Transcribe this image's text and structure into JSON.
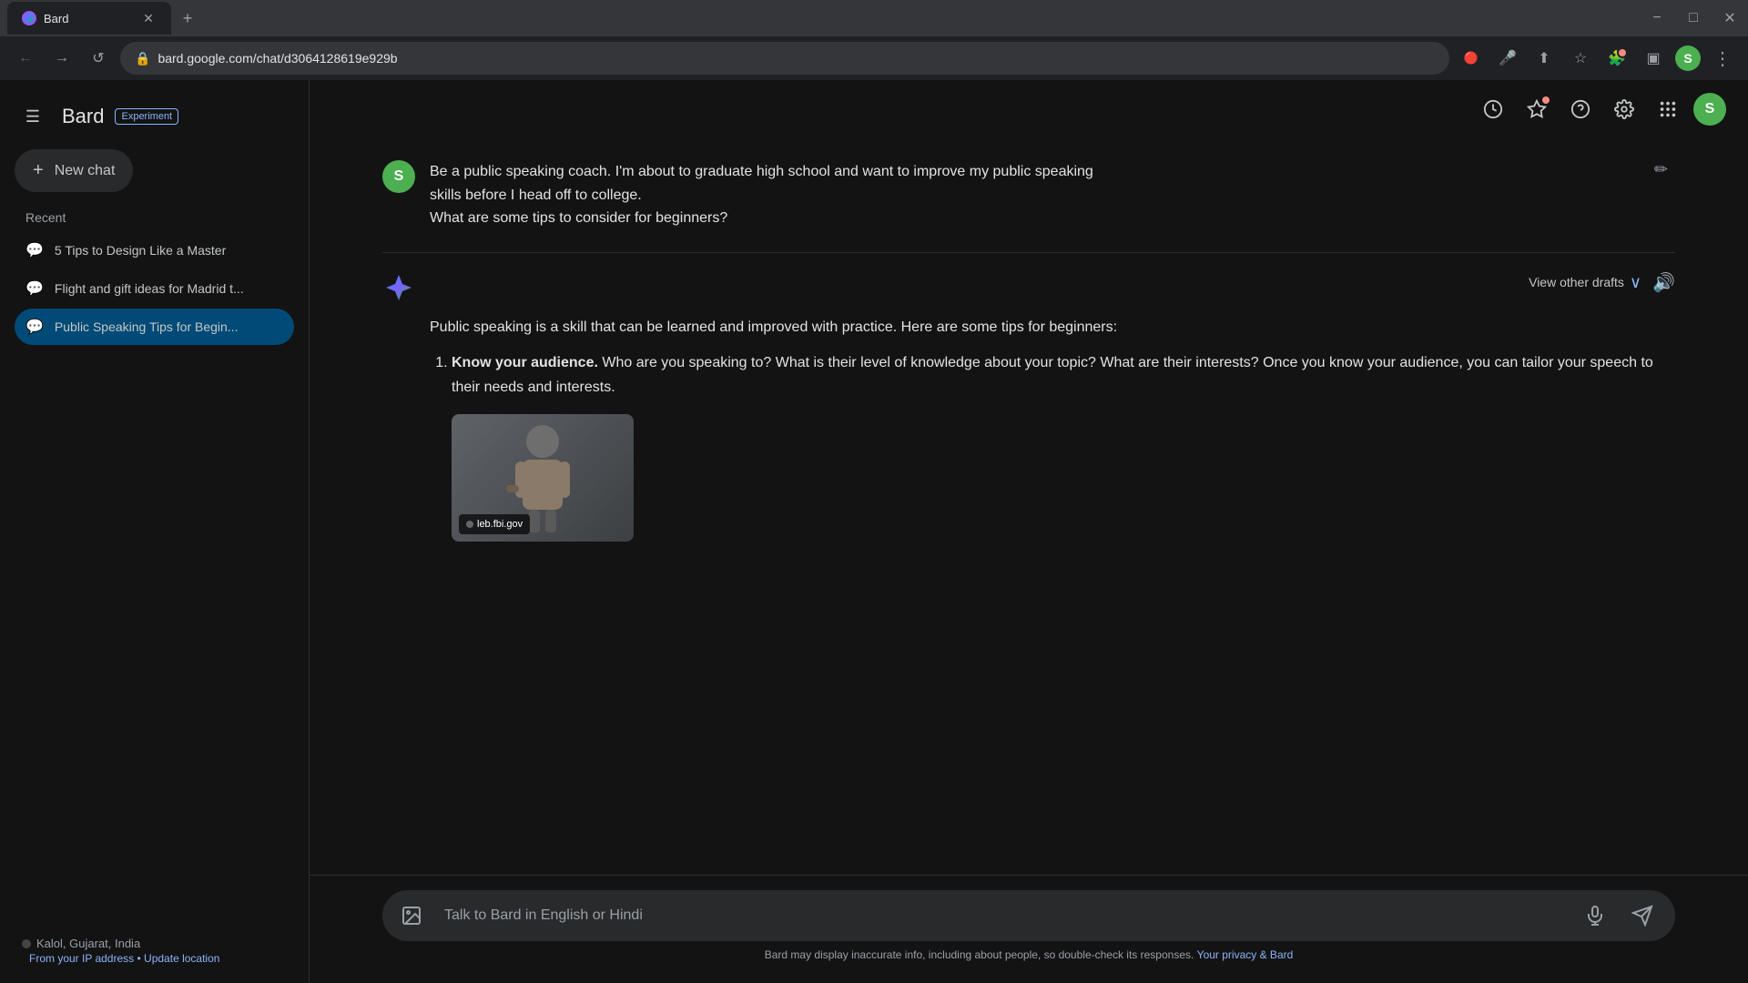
{
  "browser": {
    "tab_title": "Bard",
    "url": "bard.google.com/chat/d3064128619e929b",
    "tab_favicon": "B"
  },
  "header": {
    "title": "Bard",
    "badge": "Experiment"
  },
  "sidebar": {
    "new_chat": "New chat",
    "recent_label": "Recent",
    "recent_items": [
      {
        "id": 1,
        "label": "5 Tips to Design Like a Master",
        "active": false
      },
      {
        "id": 2,
        "label": "Flight and gift ideas for Madrid t...",
        "active": false
      },
      {
        "id": 3,
        "label": "Public Speaking Tips for Begin...",
        "active": true
      }
    ],
    "location": "Kalol, Gujarat, India",
    "location_sub": "From your IP address",
    "update_location": "Update location"
  },
  "user_message": {
    "avatar_letter": "S",
    "text_line1": "Be a public speaking coach. I'm about to graduate high school and want to improve my public speaking",
    "text_line2": "skills before I head off to college.",
    "text_line3": "What are some tips to consider for beginners?"
  },
  "bard_response": {
    "view_drafts": "View other drafts",
    "intro": "Public speaking is a skill that can be learned and improved with practice. Here are some tips for beginners:",
    "tip1_title": "Know your audience.",
    "tip1_body": "Who are you speaking to? What is their level of knowledge about your topic? What are their interests? Once you know your audience, you can tailor your speech to their needs and interests.",
    "image_source": "leb.fbi.gov"
  },
  "input": {
    "placeholder": "Talk to Bard in English or Hindi"
  },
  "disclaimer": {
    "text": "Bard may display inaccurate info, including about people, so double-check its responses.",
    "link_text": "Your privacy & Bard"
  },
  "icons": {
    "hamburger": "☰",
    "new_chat_plus": "+",
    "recent_chat": "💬",
    "history": "🕐",
    "star": "✦",
    "help": "?",
    "settings": "⚙",
    "grid": "⋯",
    "edit_pencil": "✏",
    "chevron_down": "∨",
    "sound": "🔊",
    "attach": "🖼",
    "mic": "🎤",
    "send": "➤",
    "back": "←",
    "forward": "→",
    "reload": "↺",
    "lock": "🔒"
  }
}
